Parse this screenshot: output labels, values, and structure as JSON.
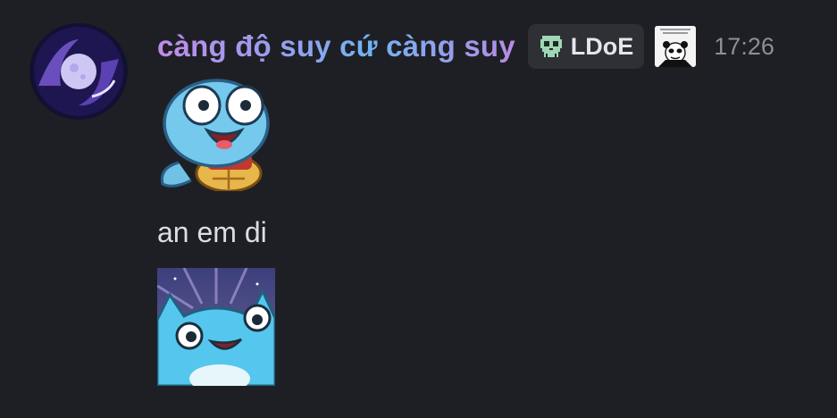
{
  "message": {
    "username": "càng độ suy cứ càng suy",
    "tag": {
      "icon": "skull-icon",
      "text": "LDoE"
    },
    "role_icon": "panda-meme-icon",
    "timestamp": "17:26",
    "text": "an em di",
    "stickers": [
      "squirtle-sticker",
      "blue-cat-sticker"
    ]
  },
  "colors": {
    "background": "#1e1f24",
    "message_text": "#dcdee3",
    "timestamp": "#8b8f98",
    "tag_background": "#2e3036"
  }
}
